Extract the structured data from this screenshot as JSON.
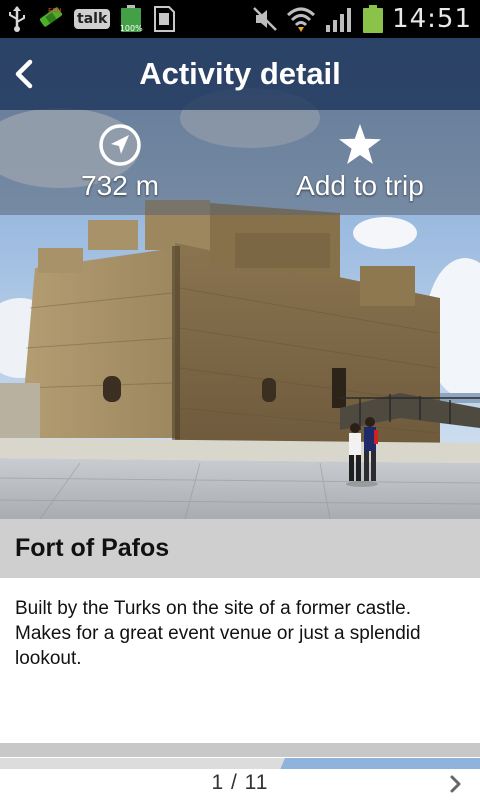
{
  "status_bar": {
    "time": "14:51",
    "talk_label": "talk",
    "battery_small_label": "100%",
    "icons": [
      "usb-icon",
      "satellite-icon",
      "talk-icon",
      "battery-small-icon",
      "sd-card-icon",
      "mute-icon",
      "wifi-icon",
      "signal-icon",
      "battery-icon"
    ]
  },
  "header": {
    "title": "Activity detail",
    "back_icon": "back-arrow-icon"
  },
  "actions": {
    "distance": {
      "icon": "compass-icon",
      "label": "732 m"
    },
    "add_to_trip": {
      "icon": "star-icon",
      "label": "Add to trip"
    }
  },
  "hero": {
    "image_subject": "fort-photo"
  },
  "activity": {
    "name": "Fort of Pafos",
    "description": "Built by the Turks on the site of a former castle. Makes for a great event venue or just a splendid lookout."
  },
  "pager": {
    "text": "1 / 11",
    "next_icon": "chevron-right-icon"
  },
  "colors": {
    "title_bar": "#243a5c",
    "name_header_bg": "#cfcfcf",
    "status_bar_bg": "#000000"
  }
}
